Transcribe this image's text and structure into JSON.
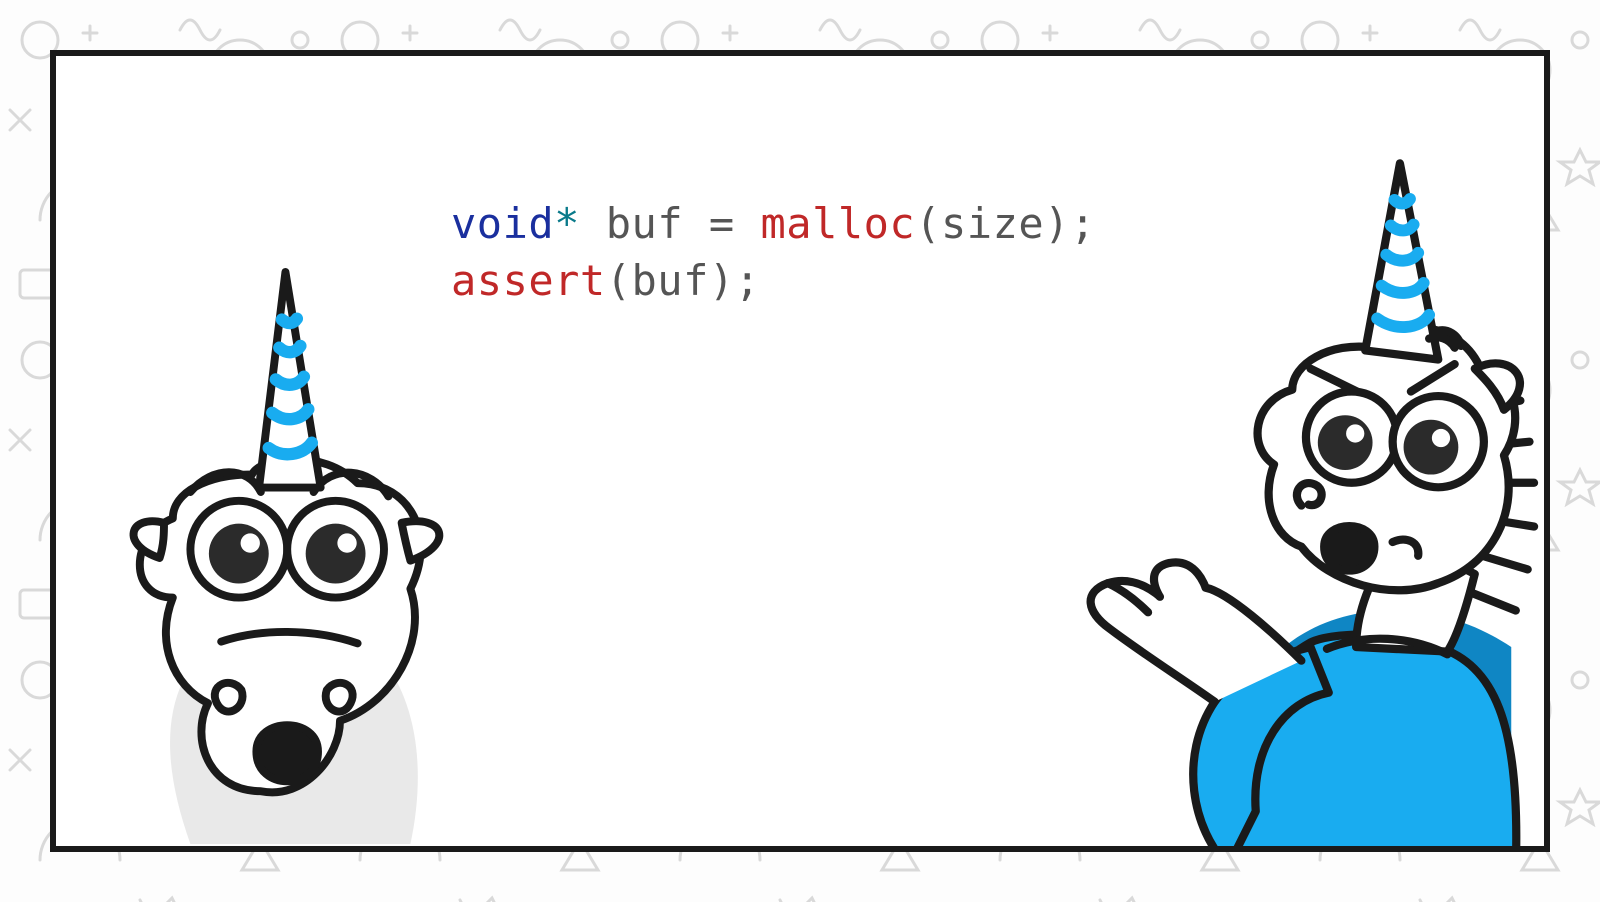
{
  "code": {
    "line1": {
      "void": "void",
      "star": "*",
      "sp1": " ",
      "buf": "buf",
      "sp2": " ",
      "eq": "=",
      "sp3": " ",
      "malloc": "malloc",
      "lp": "(",
      "size": "size",
      "rp": ")",
      "semi": ";"
    },
    "line2": {
      "assert": "assert",
      "lp": "(",
      "buf": "buf",
      "rp": ")",
      "semi": ";"
    }
  },
  "characters": {
    "left": "surprised-unicorn",
    "right": "pointing-unicorn"
  },
  "colors": {
    "accent": "#19acf0",
    "keyword": "#1a2f9e",
    "function": "#c02828",
    "identifier": "#555555",
    "border": "#1a1a1a"
  }
}
